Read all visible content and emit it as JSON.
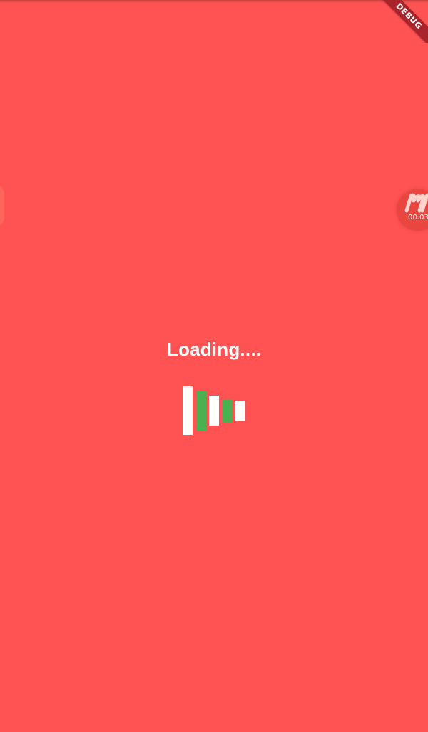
{
  "banner": {
    "label": "DEBUG"
  },
  "recorder": {
    "logo_icon": "recorder-logo-icon",
    "timer": "00:03"
  },
  "loader": {
    "text": "Loading....",
    "bars": [
      {
        "color": "#ffffff",
        "level": 1.0
      },
      {
        "color": "#4caf50",
        "level": 0.82
      },
      {
        "color": "#ffffff",
        "level": 0.62
      },
      {
        "color": "#4caf50",
        "level": 0.46
      },
      {
        "color": "#ffffff",
        "level": 0.41
      }
    ]
  },
  "colors": {
    "background": "#ff5252",
    "accent_green": "#4caf50",
    "banner": "#a8232a",
    "text": "#ffffff"
  }
}
